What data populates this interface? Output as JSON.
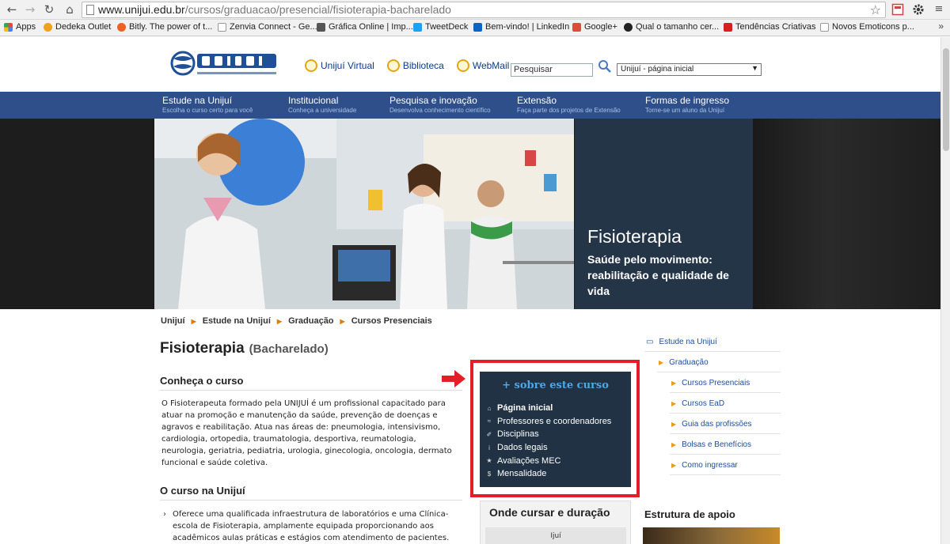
{
  "browser": {
    "url_domain": "www.unijui.edu.br",
    "url_path": "/cursos/graduacao/presencial/fisioterapia-bacharelado",
    "bookmarks": [
      {
        "label": "Apps",
        "color": "#e8453c"
      },
      {
        "label": "Dedeka Outlet",
        "color": "#f0a020"
      },
      {
        "label": "Bitly. The power of t...",
        "color": "#ee6123"
      },
      {
        "label": "Zenvia Connect - Ge...",
        "color": "#ffffff"
      },
      {
        "label": "Gráfica Online | Imp...",
        "color": "#555555"
      },
      {
        "label": "TweetDeck",
        "color": "#1da1f2"
      },
      {
        "label": "Bem-vindo! | LinkedIn",
        "color": "#0a66c2"
      },
      {
        "label": "Google+",
        "color": "#dd4b39"
      },
      {
        "label": "Qual o tamanho cer...",
        "color": "#222222"
      },
      {
        "label": "Tendências Criativas",
        "color": "#d81e1e"
      },
      {
        "label": "Novos Emoticons p...",
        "color": "#ffffff"
      }
    ],
    "more_bookmarks": "»"
  },
  "header": {
    "links": [
      "Unijuí Virtual",
      "Biblioteca",
      "WebMail"
    ],
    "search_value": "Pesquisar",
    "select_value": "Unijuí - página inicial"
  },
  "menu": [
    {
      "title": "Estude na Unijuí",
      "sub": "Escolha o curso certo para você"
    },
    {
      "title": "Institucional",
      "sub": "Conheça a universidade"
    },
    {
      "title": "Pesquisa e inovação",
      "sub": "Desenvolva conhecimento científico"
    },
    {
      "title": "Extensão",
      "sub": "Faça parte dos projetos de Extensão"
    },
    {
      "title": "Formas de ingresso",
      "sub": "Torne-se um aluno da Unijuí"
    }
  ],
  "hero": {
    "title": "Fisioterapia",
    "subtitle": "Saúde pelo movimento: reabilitação e qualidade de vida"
  },
  "breadcrumb": [
    "Unijuí",
    "Estude na Unijuí",
    "Graduação",
    "Cursos Presenciais"
  ],
  "course": {
    "title": "Fisioterapia",
    "degree": "(Bacharelado)",
    "section1_title": "Conheça o curso",
    "section1_text": "O Fisioterapeuta formado pela UNIJUÍ é um profissional capacitado para atuar na promoção e manutenção da saúde, prevenção de doenças e agravos e reabilitação. Atua nas áreas de: pneumologia, intensivismo, cardiologia, ortopedia, traumatologia, desportiva, reumatologia, neurologia, geriatria, pediatria, urologia, ginecologia, oncologia, dermato funcional e saúde coletiva.",
    "section2_title": "O curso na Unijuí",
    "section2_bullet": "Oferece uma qualificada infraestrutura de laboratórios e uma Clínica-escola de Fisioterapia, amplamente equipada proporcionando aos acadêmicos aulas práticas e estágios com atendimento de pacientes."
  },
  "about": {
    "title": "+ sobre este curso",
    "items": [
      {
        "icon": "⌂",
        "label": "Página inicial"
      },
      {
        "icon": "≈",
        "label": "Professores e coordenadores"
      },
      {
        "icon": "✐",
        "label": "Disciplinas"
      },
      {
        "icon": "i",
        "label": "Dados legais"
      },
      {
        "icon": "★",
        "label": "Avaliações MEC"
      },
      {
        "icon": "$",
        "label": "Mensalidade"
      }
    ]
  },
  "onde": {
    "title": "Onde cursar e duração",
    "row": "Ijuí"
  },
  "estrutura": {
    "title": "Estrutura de apoio"
  },
  "side_nav": [
    "Estude na Unijuí",
    "Graduação",
    "Cursos Presenciais",
    "Cursos EaD",
    "Guia das profissões",
    "Bolsas e Benefícios",
    "Como ingressar"
  ]
}
